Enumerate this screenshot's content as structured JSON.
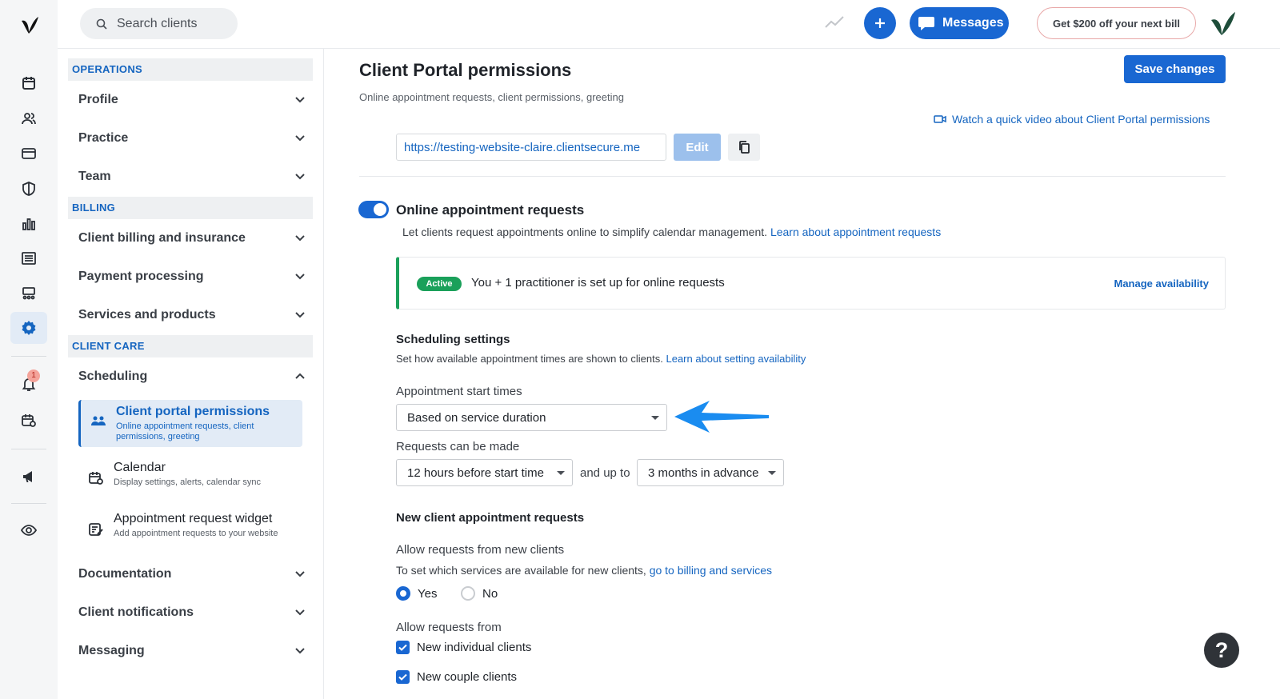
{
  "topbar": {
    "search_placeholder": "Search clients",
    "messages_label": "Messages",
    "promo_label": "Get $200 off your next bill"
  },
  "rail": {
    "notification_count": "1",
    "icons": [
      "logo-icon",
      "calendar-icon",
      "clients-icon",
      "billing-card-icon",
      "shield-icon",
      "reports-chart-icon",
      "list-icon",
      "practice-icon",
      "settings-gear-icon",
      "bell-icon",
      "calendar-settings-icon",
      "megaphone-icon",
      "eye-icon"
    ]
  },
  "sidenav": {
    "operations_header": "OPERATIONS",
    "profile": "Profile",
    "practice": "Practice",
    "team": "Team",
    "billing_header": "BILLING",
    "client_billing": "Client billing and insurance",
    "payment_processing": "Payment processing",
    "services_products": "Services and products",
    "client_care_header": "CLIENT CARE",
    "scheduling": "Scheduling",
    "sub": [
      {
        "title": "Client portal permissions",
        "desc": "Online appointment requests, client permissions, greeting"
      },
      {
        "title": "Calendar",
        "desc": "Display settings, alerts, calendar sync"
      },
      {
        "title": "Appointment request widget",
        "desc": "Add appointment requests to your website"
      }
    ],
    "documentation": "Documentation",
    "client_notifications": "Client notifications",
    "messaging": "Messaging"
  },
  "main": {
    "title": "Client Portal permissions",
    "subtitle": "Online appointment requests, client permissions, greeting",
    "save_label": "Save changes",
    "video_link": "Watch a quick video about Client Portal permissions",
    "portal_url": "https://testing-website-claire.clientsecure.me",
    "edit_label": "Edit",
    "oar_title": "Online appointment requests",
    "oar_desc": "Let clients request appointments online to simplify calendar management.",
    "oar_link": "Learn about appointment requests",
    "status_badge": "Active",
    "status_text": "You + 1 practitioner is set up for online requests",
    "manage_link": "Manage availability",
    "sched_title": "Scheduling settings",
    "sched_desc": "Set how available appointment times are shown to clients.",
    "sched_link": "Learn about setting availability",
    "start_times_label": "Appointment start times",
    "start_times_value": "Based on service duration",
    "requests_label": "Requests can be made",
    "requests_min_value": "12 hours before start time",
    "and_up_to": "and up to",
    "requests_max_value": "3 months in advance",
    "new_client_title": "New client appointment requests",
    "allow_new_label": "Allow requests from new clients",
    "allow_new_desc": "To set which services are available for new clients,",
    "allow_new_link": "go to billing and services",
    "radio_yes": "Yes",
    "radio_no": "No",
    "allow_from_label": "Allow requests from",
    "check_individual": "New individual clients",
    "check_couple": "New couple clients"
  },
  "help_label": "?"
}
